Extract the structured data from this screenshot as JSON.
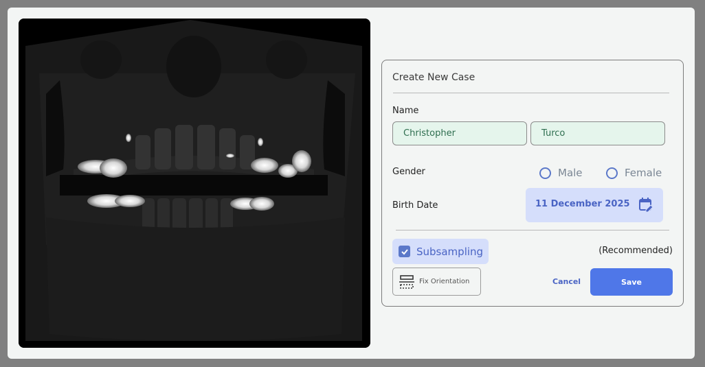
{
  "dialog": {
    "title": "Create New Case",
    "name_label": "Name",
    "first_name": "Christopher",
    "last_name": "Turco",
    "gender_label": "Gender",
    "gender_options": [
      "Male",
      "Female"
    ],
    "birth_date_label": "Birth Date",
    "birth_date_value": "11 December 2025",
    "subsampling_label": "Subsampling",
    "subsampling_checked": true,
    "recommended_label": "(Recommended)",
    "fix_orientation_label": "Fix Orientation",
    "cancel_label": "Cancel",
    "save_label": "Save"
  },
  "icons": {
    "calendar": "calendar-edit-icon",
    "checkbox": "check-icon",
    "orientation": "orientation-icon"
  },
  "colors": {
    "accent": "#4f77e8",
    "accent_text": "#4a64c4",
    "accent_bg": "#d5defb",
    "field_bg": "#e5f5ec"
  }
}
